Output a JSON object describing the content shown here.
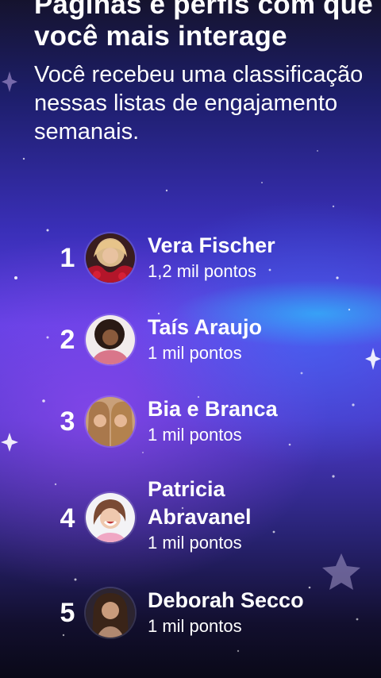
{
  "header": {
    "title": "Páginas e perfis com que você mais interage",
    "subtitle": "Você recebeu uma classificação nessas listas de engajamento semanais."
  },
  "ranking": [
    {
      "rank": "1",
      "name": "Vera Fischer",
      "points": "1,2 mil pontos"
    },
    {
      "rank": "2",
      "name": "Taís Araujo",
      "points": "1 mil pontos"
    },
    {
      "rank": "3",
      "name": "Bia e Branca",
      "points": "1 mil pontos"
    },
    {
      "rank": "4",
      "name": "Patricia Abravanel",
      "points": "1 mil pontos"
    },
    {
      "rank": "5",
      "name": "Deborah Secco",
      "points": "1 mil pontos"
    }
  ],
  "colors": {
    "text": "#ffffff",
    "background_top": "#15132e",
    "background_mid": "#5a3fe0",
    "glow": "#28dcff"
  }
}
